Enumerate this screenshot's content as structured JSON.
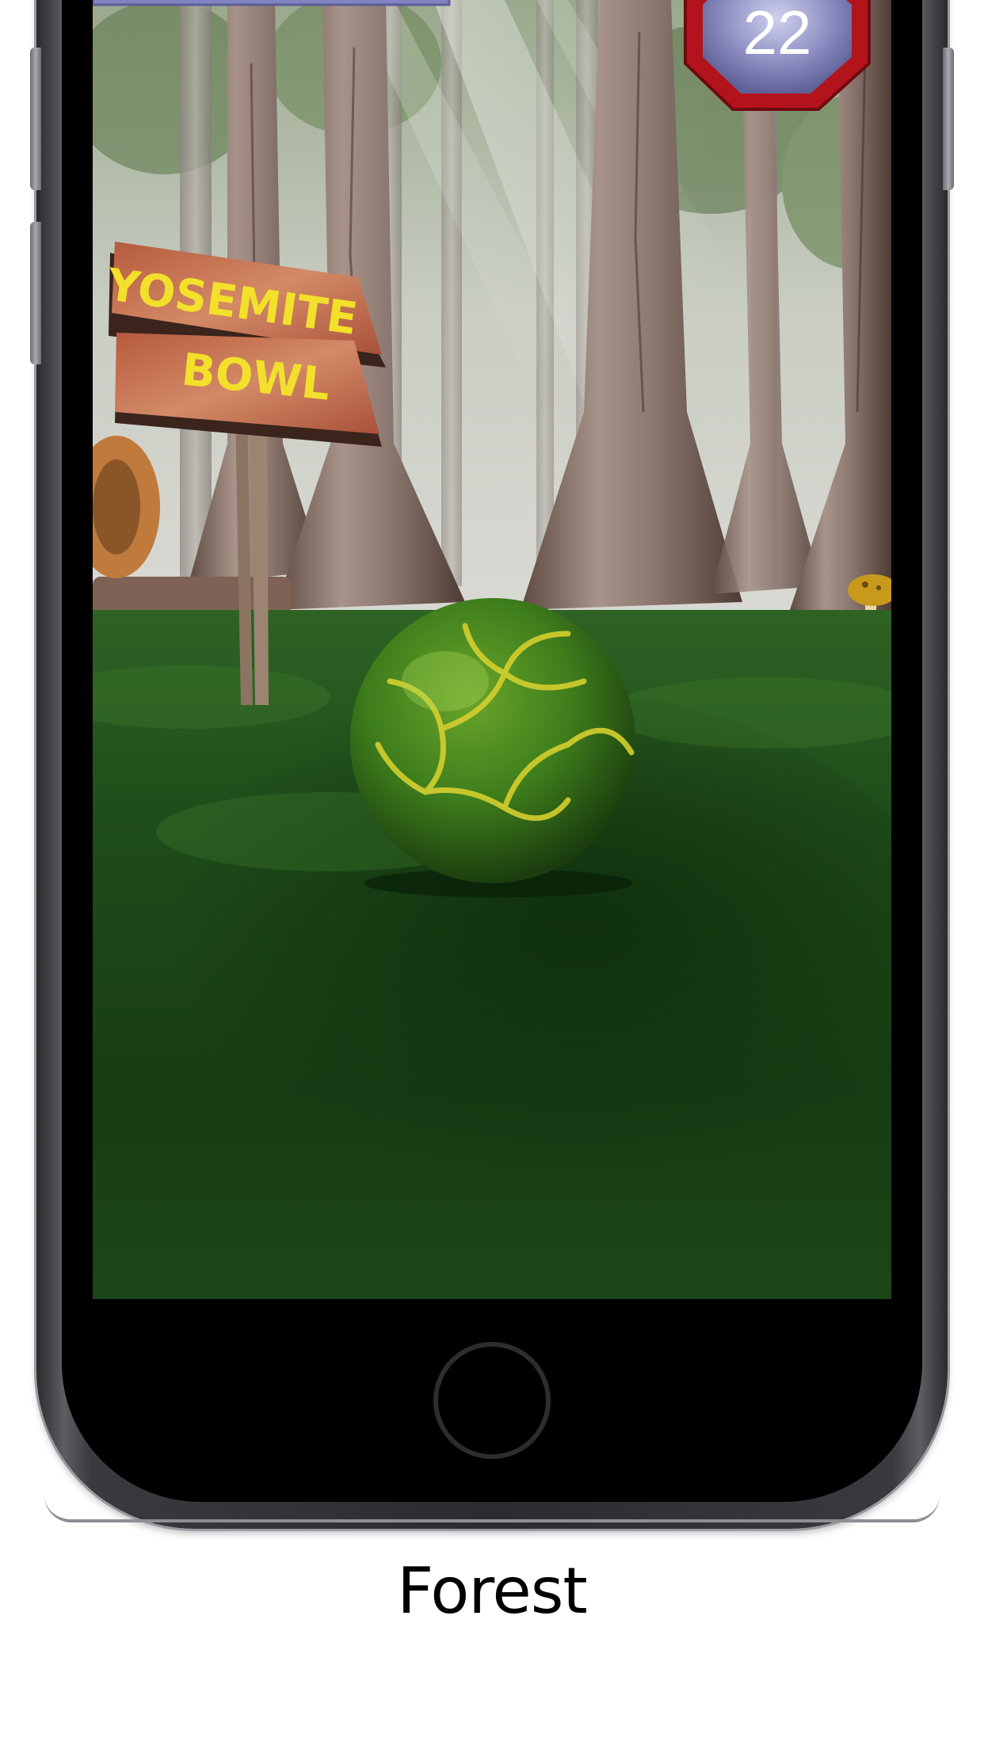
{
  "game": {
    "level_number": "22",
    "sign": {
      "line1": "YOSEMITE",
      "line2": "BOWL"
    }
  },
  "caption": "Forest",
  "colors": {
    "grass": "#1f4a1a",
    "ball_green": "#3e7d1c",
    "ball_veins": "#d4cf2e",
    "sign_wood": "#c6694a",
    "sign_text": "#f2e02a",
    "badge_red": "#b3141c",
    "badge_face": "#7d7fb5"
  }
}
